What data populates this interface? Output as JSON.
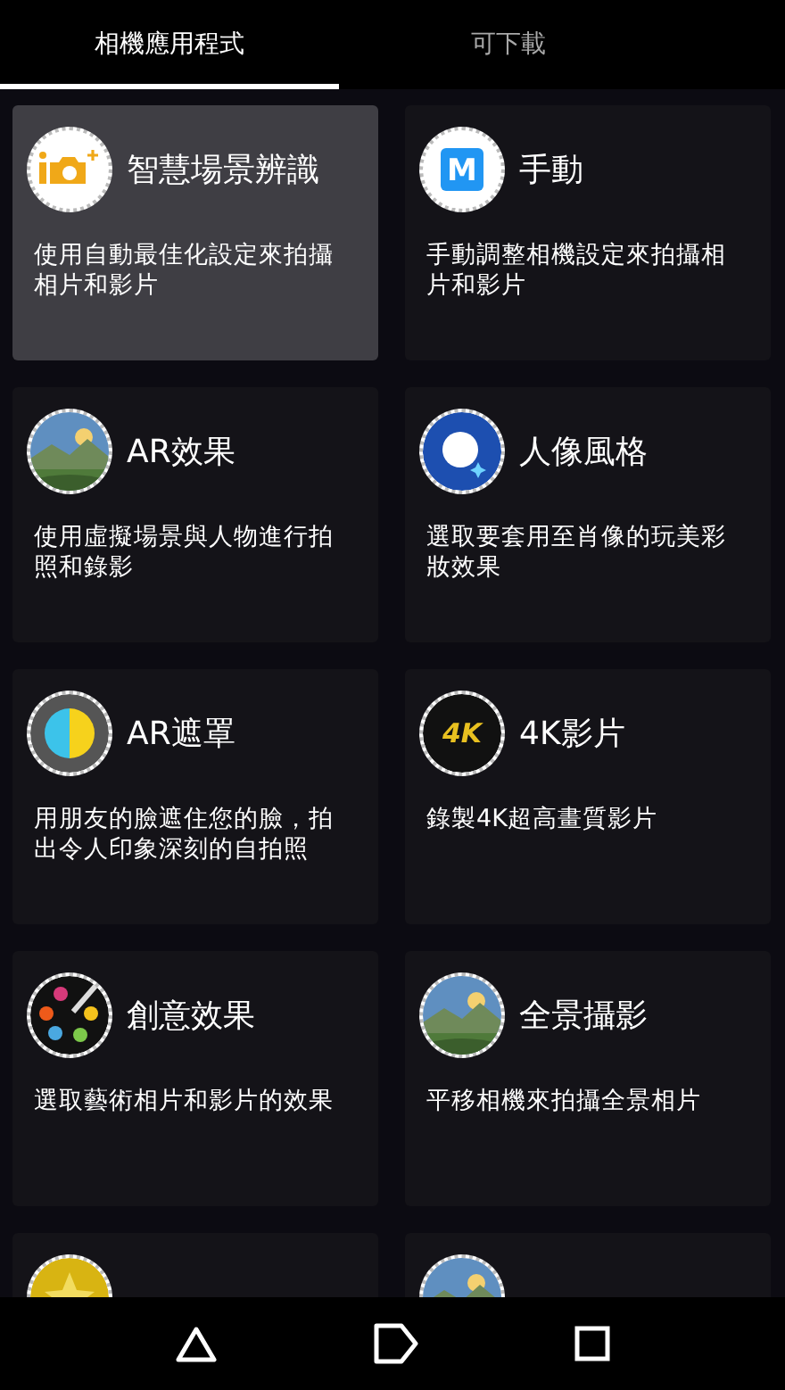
{
  "tabs": [
    {
      "label": "相機應用程式",
      "selected": true
    },
    {
      "label": "可下載",
      "selected": false
    }
  ],
  "apps": [
    {
      "title": "智慧場景辨識",
      "description": "使用自動最佳化設定來拍攝相片和影片",
      "selected": true,
      "kind": "camera"
    },
    {
      "title": "手動",
      "description": "手動調整相機設定來拍攝相片和影片",
      "selected": false,
      "kind": "manual",
      "icon_text": "M"
    },
    {
      "title": "AR效果",
      "description": "使用虛擬場景與人物進行拍照和錄影",
      "selected": false,
      "kind": "picture"
    },
    {
      "title": "人像風格",
      "description": "選取要套用至肖像的玩美彩妝效果",
      "selected": false,
      "kind": "portrait"
    },
    {
      "title": "AR遮罩",
      "description": "用朋友的臉遮住您的臉，拍出令人印象深刻的自拍照",
      "selected": false,
      "kind": "mask"
    },
    {
      "title": "4K影片",
      "description": "錄製4K超高畫質影片",
      "selected": false,
      "kind": "video4k",
      "icon_text": "4K"
    },
    {
      "title": "創意效果",
      "description": "選取藝術相片和影片的效果",
      "selected": false,
      "kind": "palette"
    },
    {
      "title": "全景攝影",
      "description": "平移相機來拍攝全景相片",
      "selected": false,
      "kind": "picture"
    },
    {
      "selected": false,
      "kind": "star"
    },
    {
      "selected": false,
      "kind": "picture"
    }
  ]
}
